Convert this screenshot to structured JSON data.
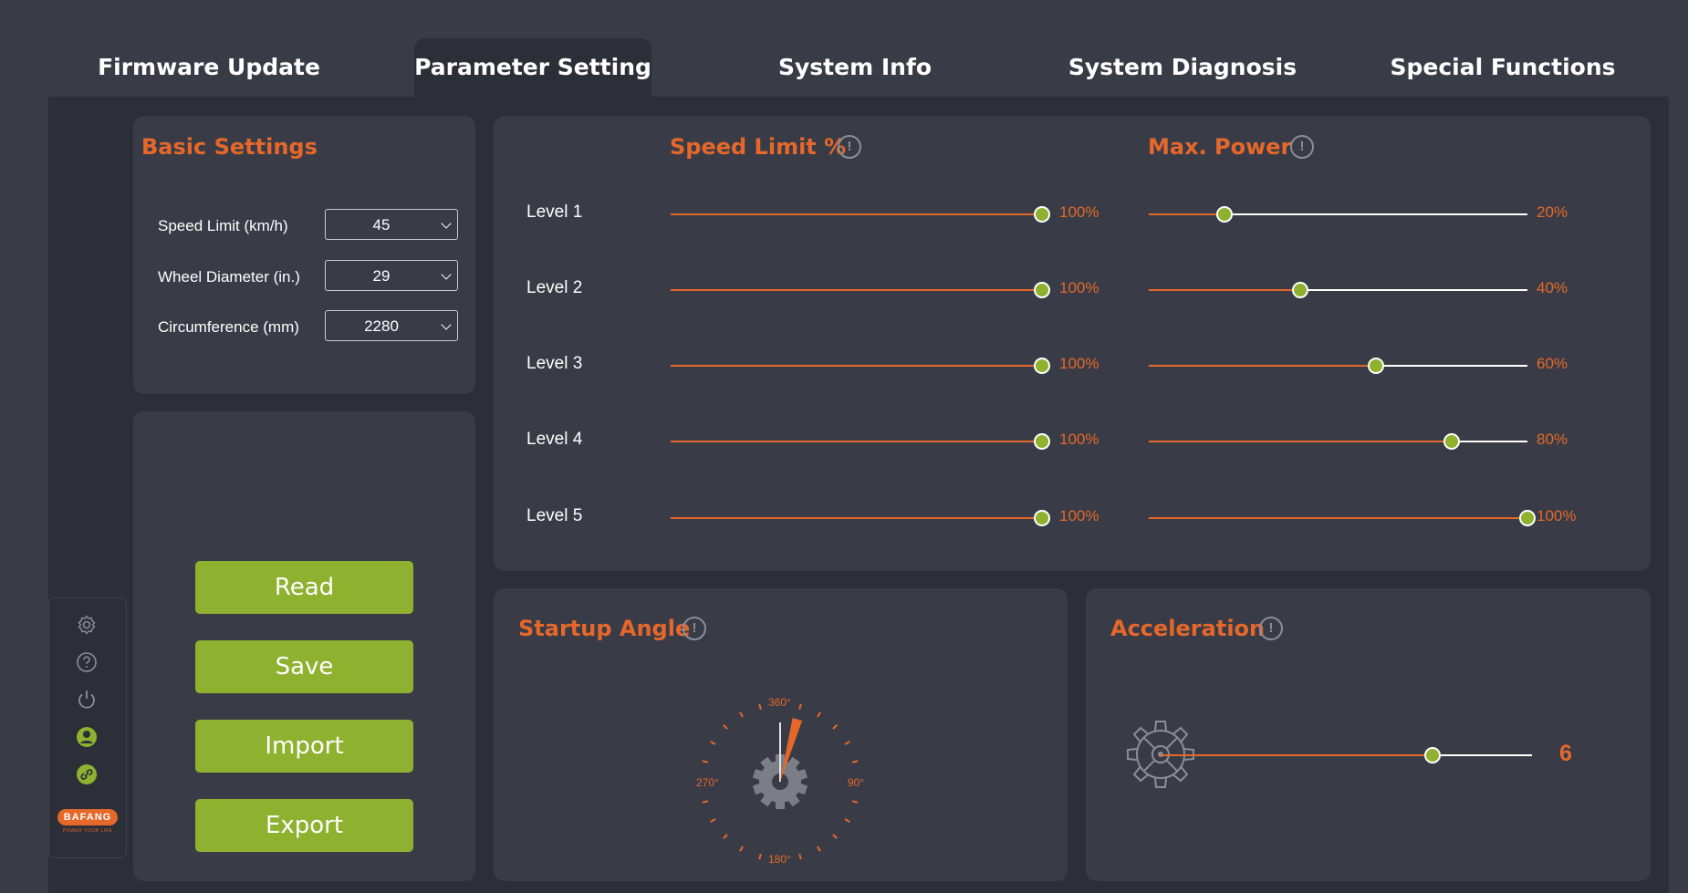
{
  "tabs": [
    {
      "label": "Firmware Update"
    },
    {
      "label": "Parameter Setting"
    },
    {
      "label": "System Info"
    },
    {
      "label": "System Diagnosis"
    },
    {
      "label": "Special Functions"
    }
  ],
  "basic": {
    "title": "Basic Settings",
    "fields": [
      {
        "label": "Speed Limit (km/h)",
        "value": "45"
      },
      {
        "label": "Wheel Diameter (in.)",
        "value": "29"
      },
      {
        "label": "Circumference (mm)",
        "value": "2280"
      }
    ]
  },
  "actions": {
    "read": "Read",
    "save": "Save",
    "import": "Import",
    "export": "Export"
  },
  "speed_limit": {
    "title": "Speed Limit %",
    "levels": [
      {
        "label": "Level 1",
        "value": 100,
        "text": "100%"
      },
      {
        "label": "Level 2",
        "value": 100,
        "text": "100%"
      },
      {
        "label": "Level 3",
        "value": 100,
        "text": "100%"
      },
      {
        "label": "Level 4",
        "value": 100,
        "text": "100%"
      },
      {
        "label": "Level 5",
        "value": 100,
        "text": "100%"
      }
    ]
  },
  "max_power": {
    "title": "Max. Power",
    "levels": [
      {
        "value": 20,
        "text": "20%"
      },
      {
        "value": 40,
        "text": "40%"
      },
      {
        "value": 60,
        "text": "60%"
      },
      {
        "value": 80,
        "text": "80%"
      },
      {
        "value": 100,
        "text": "100%"
      }
    ]
  },
  "startup_angle": {
    "title": "Startup Angle",
    "labels": {
      "top": "360°",
      "right": "90°",
      "bottom": "180°",
      "left": "270°"
    },
    "value_deg": 15
  },
  "acceleration": {
    "title": "Acceleration",
    "value": "6",
    "fraction": 0.733
  },
  "sidebar": {
    "icons": [
      "gear-icon",
      "help-icon",
      "power-icon",
      "user-icon",
      "link-icon"
    ],
    "logo_text": "BAFANG",
    "logo_tagline": "POWER YOUR LIFE"
  },
  "colors": {
    "accent": "#e5682a",
    "green": "#8fb130",
    "background": "#393c47",
    "panel": "#2c2f38"
  }
}
